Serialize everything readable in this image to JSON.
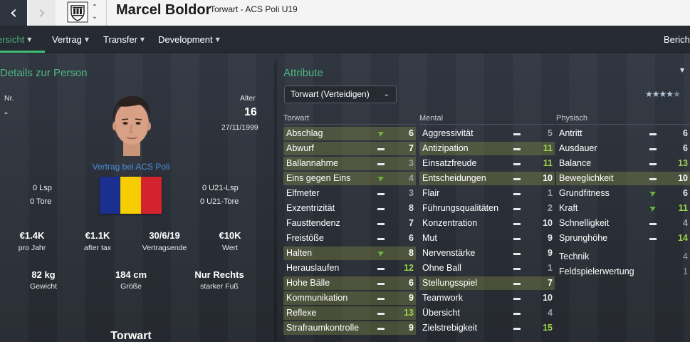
{
  "titlebar": {
    "back_icon": "‹",
    "forward_icon": "›",
    "updown_up": "⌃",
    "updown_down": "⌄",
    "player_name": "Marcel Boldor",
    "player_subtitle": "Torwart - ACS Poli U19"
  },
  "tabs": [
    {
      "label": "ersicht",
      "active": true
    },
    {
      "label": "Vertrag"
    },
    {
      "label": "Transfer"
    },
    {
      "label": "Development"
    },
    {
      "label": "Berich"
    }
  ],
  "details": {
    "title": "Details zur Person",
    "nr_label": "Nr.",
    "nr_value": "-",
    "age_label": "Alter",
    "age_value": "16",
    "birthdate": "27/11/1999",
    "contract_note": "Vertrag bei ACS Poli",
    "lsp": "0 Lsp",
    "tore": "0 Tore",
    "u21_lsp": "0 U21-Lsp",
    "u21_tore": "0 U21-Tore",
    "flag_colors": [
      "#1b2f8f",
      "#f5cd00",
      "#d2232f"
    ],
    "finance": [
      {
        "value": "€1.4K",
        "label": "pro Jahr"
      },
      {
        "value": "€1.1K",
        "label": "after tax"
      },
      {
        "value": "30/6/19",
        "label": "Vertragsende"
      },
      {
        "value": "€10K",
        "label": "Wert"
      }
    ],
    "physical": [
      {
        "value": "82 kg",
        "label": "Gewicht"
      },
      {
        "value": "184 cm",
        "label": "Größe"
      },
      {
        "value": "Nur Rechts",
        "label": "starker Fuß"
      }
    ],
    "position": "Torwart"
  },
  "attributes": {
    "title": "Attribute",
    "role_select": "Torwart (Verteidigen)",
    "rating_stars": 4,
    "columns": [
      {
        "heading": "Torwart",
        "rows": [
          {
            "name": "Abschlag",
            "trend": "up",
            "value": 6,
            "hl": true
          },
          {
            "name": "Abwurf",
            "trend": "flat",
            "value": 7,
            "hl": true
          },
          {
            "name": "Ballannahme",
            "trend": "flat",
            "value": 3,
            "hl": true
          },
          {
            "name": "Eins gegen Eins",
            "trend": "up",
            "value": 4,
            "hl": true
          },
          {
            "name": "Elfmeter",
            "trend": "flat",
            "value": 3,
            "hl": false
          },
          {
            "name": "Exzentrizität",
            "trend": "flat",
            "value": 8,
            "hl": false
          },
          {
            "name": "Fausttendenz",
            "trend": "flat",
            "value": 7,
            "hl": false
          },
          {
            "name": "Freistöße",
            "trend": "flat",
            "value": 6,
            "hl": false
          },
          {
            "name": "Halten",
            "trend": "up",
            "value": 8,
            "hl": true
          },
          {
            "name": "Herauslaufen",
            "trend": "flat",
            "value": 12,
            "hl": false
          },
          {
            "name": "Hohe Bälle",
            "trend": "flat",
            "value": 6,
            "hl": true
          },
          {
            "name": "Kommunikation",
            "trend": "flat",
            "value": 9,
            "hl": true
          },
          {
            "name": "Reflexe",
            "trend": "flat",
            "value": 13,
            "hl": true
          },
          {
            "name": "Strafraumkontrolle",
            "trend": "flat",
            "value": 9,
            "hl": true
          }
        ]
      },
      {
        "heading": "Mental",
        "rows": [
          {
            "name": "Aggressivität",
            "trend": "flat",
            "value": 5,
            "hl": false
          },
          {
            "name": "Antizipation",
            "trend": "flat",
            "value": 11,
            "hl": true
          },
          {
            "name": "Einsatzfreude",
            "trend": "flat",
            "value": 11,
            "hl": false
          },
          {
            "name": "Entscheidungen",
            "trend": "flat",
            "value": 10,
            "hl": true
          },
          {
            "name": "Flair",
            "trend": "flat",
            "value": 1,
            "hl": false
          },
          {
            "name": "Führungsqualitäten",
            "trend": "flat",
            "value": 2,
            "hl": false
          },
          {
            "name": "Konzentration",
            "trend": "flat",
            "value": 10,
            "hl": false
          },
          {
            "name": "Mut",
            "trend": "flat",
            "value": 9,
            "hl": false
          },
          {
            "name": "Nervenstärke",
            "trend": "flat",
            "value": 9,
            "hl": false
          },
          {
            "name": "Ohne Ball",
            "trend": "flat",
            "value": 1,
            "hl": false
          },
          {
            "name": "Stellungsspiel",
            "trend": "flat",
            "value": 7,
            "hl": true
          },
          {
            "name": "Teamwork",
            "trend": "flat",
            "value": 10,
            "hl": false
          },
          {
            "name": "Übersicht",
            "trend": "flat",
            "value": 4,
            "hl": false
          },
          {
            "name": "Zielstrebigkeit",
            "trend": "flat",
            "value": 15,
            "hl": false
          }
        ]
      },
      {
        "heading": "Physisch",
        "rows": [
          {
            "name": "Antritt",
            "trend": "flat",
            "value": 6,
            "hl": false
          },
          {
            "name": "Ausdauer",
            "trend": "flat",
            "value": 6,
            "hl": false
          },
          {
            "name": "Balance",
            "trend": "flat",
            "value": 13,
            "hl": false
          },
          {
            "name": "Beweglichkeit",
            "trend": "flat",
            "value": 10,
            "hl": true
          },
          {
            "name": "Grundfitness",
            "trend": "up",
            "value": 6,
            "hl": false
          },
          {
            "name": "Kraft",
            "trend": "up",
            "value": 11,
            "hl": false
          },
          {
            "name": "Schnelligkeit",
            "trend": "flat",
            "value": 4,
            "hl": false
          },
          {
            "name": "Sprunghöhe",
            "trend": "flat",
            "value": 14,
            "hl": false
          }
        ],
        "extra": [
          {
            "name": "Technik",
            "value": 4
          },
          {
            "name": "Feldspielerwertung",
            "value": 1
          }
        ]
      }
    ]
  }
}
